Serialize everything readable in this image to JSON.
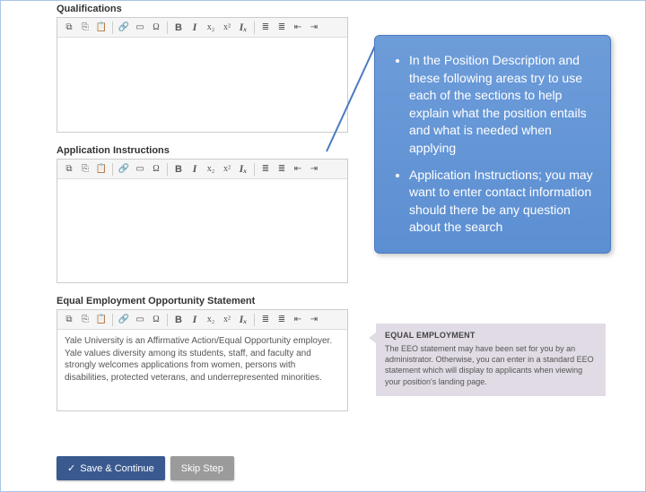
{
  "sections": {
    "qualifications": {
      "title": "Qualifications",
      "body": ""
    },
    "application_instructions": {
      "title": "Application Instructions",
      "body": ""
    },
    "eeo": {
      "title": "Equal Employment Opportunity Statement",
      "body": "Yale University is an Affirmative Action/Equal Opportunity employer. Yale values diversity among its students, staff, and faculty and strongly welcomes applications from women, persons with disabilities, protected veterans, and underrepresented minorities."
    }
  },
  "toolbar": {
    "source": "⧉",
    "copy": "⎘",
    "paste": "📋",
    "link": "🔗",
    "image": "▭",
    "omega": "Ω",
    "bold": "B",
    "italic": "I",
    "strike": "x₂",
    "super": "x²",
    "clear": "Iₓ",
    "ul": "≣",
    "ol": "≣",
    "outdent": "⇤",
    "indent": "⇥"
  },
  "callout": {
    "b1": "In the Position Description and these following areas try to use each of the sections to help explain what the position entails and what is needed when applying",
    "b2": "Application Instructions; you may want to enter contact information should there be any question about the search"
  },
  "eeo_hint": {
    "title": "EQUAL EMPLOYMENT",
    "text": "The EEO statement may have been set for you by an administrator. Otherwise, you can enter in a standard EEO statement which will display to applicants when viewing your position's landing page."
  },
  "buttons": {
    "save": "Save & Continue",
    "skip": "Skip Step"
  }
}
